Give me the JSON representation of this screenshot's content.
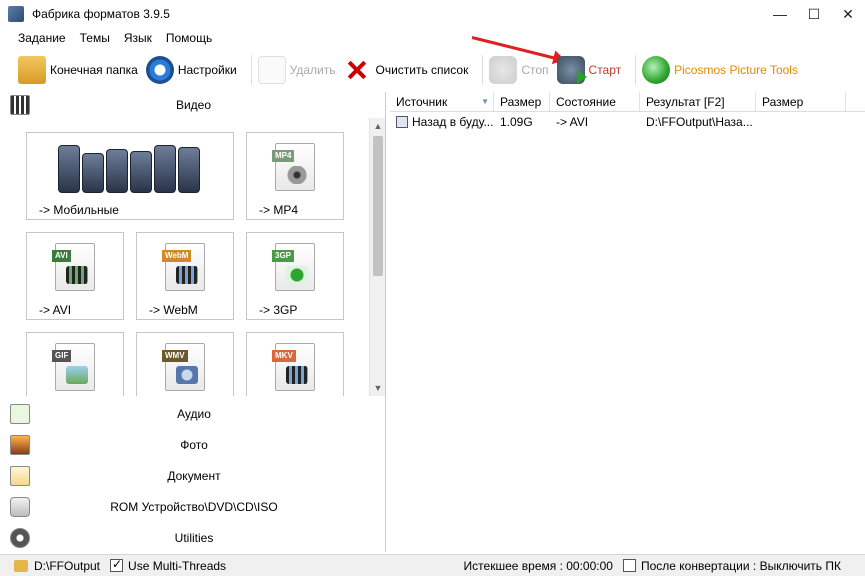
{
  "window": {
    "title": "Фабрика форматов 3.9.5",
    "controls": {
      "minimize": "—",
      "maximize": "☐",
      "close": "✕"
    }
  },
  "menu": [
    "Задание",
    "Темы",
    "Язык",
    "Помощь"
  ],
  "toolbar": {
    "output_folder": "Конечная папка",
    "settings": "Настройки",
    "delete": "Удалить",
    "clear_list": "Очистить список",
    "stop": "Стоп",
    "start": "Старт",
    "picosmos": "Picosmos Picture Tools"
  },
  "left_panel": {
    "video_header": "Видео",
    "tiles": [
      {
        "label": "-> Мобильные",
        "icon": "mobile-phones-icon"
      },
      {
        "label": "-> MP4",
        "icon": "mp4-file-icon",
        "badge": "MP4"
      },
      {
        "label": "-> AVI",
        "icon": "avi-file-icon",
        "badge": "AVI"
      },
      {
        "label": "-> WebM",
        "icon": "webm-file-icon",
        "badge": "WebM"
      },
      {
        "label": "-> 3GP",
        "icon": "3gp-file-icon",
        "badge": "3GP"
      },
      {
        "label": "",
        "icon": "gif-file-icon",
        "badge": "GIF"
      },
      {
        "label": "",
        "icon": "wmv-file-icon",
        "badge": "WMV"
      },
      {
        "label": "",
        "icon": "mkv-file-icon",
        "badge": "MKV"
      }
    ],
    "categories": [
      {
        "label": "Аудио",
        "icon": "audio-icon"
      },
      {
        "label": "Фото",
        "icon": "photo-icon"
      },
      {
        "label": "Документ",
        "icon": "document-icon"
      },
      {
        "label": "ROM Устройство\\DVD\\CD\\ISO",
        "icon": "disc-drive-icon"
      },
      {
        "label": "Utilities",
        "icon": "utilities-icon"
      }
    ]
  },
  "table": {
    "headers": [
      "Источник",
      "Размер",
      "Состояние",
      "Результат [F2]",
      "Размер"
    ],
    "rows": [
      {
        "source": "Назад в буду...",
        "size": "1.09G",
        "state": "-> AVI",
        "result": "D:\\FFOutput\\Наза...",
        "out_size": ""
      }
    ]
  },
  "statusbar": {
    "output_path": "D:\\FFOutput",
    "multithreads": "Use Multi-Threads",
    "elapsed": "Истекшее время : 00:00:00",
    "after_convert": "После конвертации : Выключить ПК"
  },
  "colors": {
    "start_label": "#c0392b",
    "picosmos_label": "#e08a00",
    "annotation_arrow": "#e02020"
  }
}
